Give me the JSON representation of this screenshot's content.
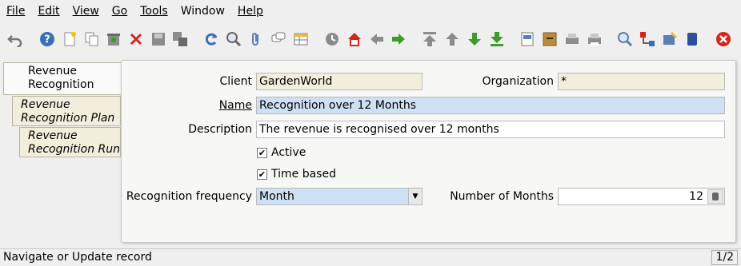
{
  "menubar": {
    "items": [
      "File",
      "Edit",
      "View",
      "Go",
      "Tools",
      "Window",
      "Help"
    ],
    "mnemonics": [
      "F",
      "E",
      "V",
      "G",
      "T",
      "",
      "H"
    ]
  },
  "toolbar": {
    "icons": [
      "undo-icon",
      "help-icon",
      "new-record-icon",
      "copy-record-icon",
      "delete-icon",
      "delete-selection-icon",
      "save-icon",
      "save-and-new-icon",
      "refresh-icon",
      "find-icon",
      "attachment-icon",
      "chat-icon",
      "grid-toggle-icon",
      "history-icon",
      "home-icon",
      "back-icon",
      "forward-icon",
      "first-record-icon",
      "previous-record-icon",
      "next-record-icon",
      "last-record-icon",
      "report-icon",
      "archive-icon",
      "print-preview-icon",
      "print-icon",
      "zoom-across-icon",
      "workflow-icon",
      "process-icon",
      "product-info-icon",
      "exit-icon"
    ]
  },
  "tabs": [
    {
      "label": "Revenue Recognition"
    },
    {
      "label": "Revenue Recognition Plan"
    },
    {
      "label": "Revenue Recognition Run"
    }
  ],
  "form": {
    "client_label": "Client",
    "client_value": "GardenWorld",
    "org_label": "Organization",
    "org_value": "*",
    "name_label": "Name",
    "name_value": "Recognition over 12 Months",
    "description_label": "Description",
    "description_value": "The revenue is recognised over 12 months",
    "active_label": "Active",
    "active_checked": true,
    "timebased_label": "Time based",
    "timebased_checked": true,
    "frequency_label": "Recognition frequency",
    "frequency_value": "Month",
    "months_label": "Number of Months",
    "months_value": "12"
  },
  "status": {
    "text": "Navigate or Update record",
    "record_count": "1/2"
  },
  "colors": {
    "readonly_bg": "#f1eedb",
    "mandatory_bg": "#cfe0f5",
    "exit_red": "#d9241c",
    "nav_green": "#3d9b2b"
  }
}
